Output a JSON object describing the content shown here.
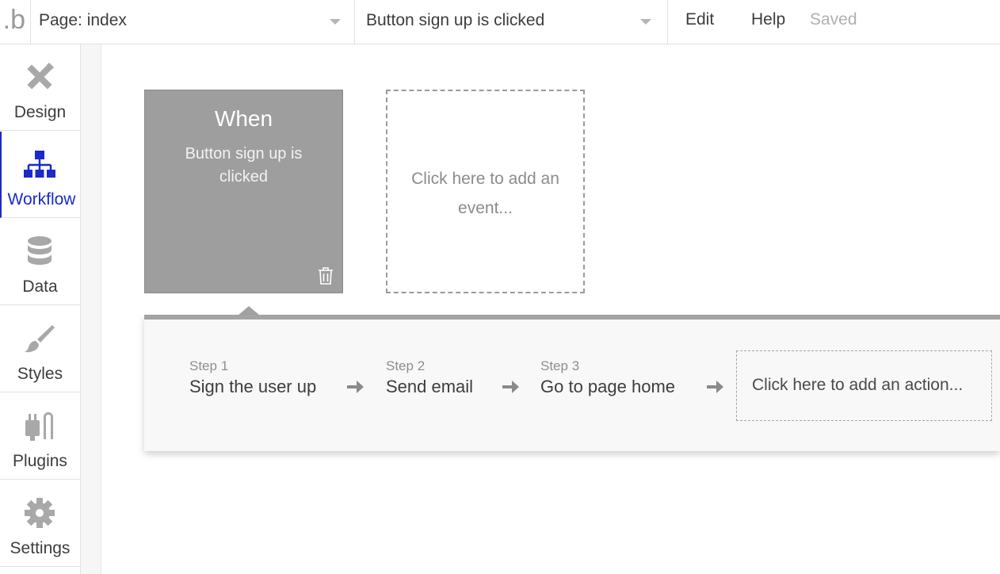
{
  "app": {
    "logo_text": ".b"
  },
  "topbar": {
    "page_select": "Page: index",
    "event_select": "Button sign up is clicked",
    "menu": {
      "edit": "Edit",
      "help": "Help",
      "status": "Saved"
    }
  },
  "sidebar": {
    "items": [
      {
        "label": "Design",
        "icon": "design-icon"
      },
      {
        "label": "Workflow",
        "icon": "workflow-icon",
        "active": true
      },
      {
        "label": "Data",
        "icon": "database-icon"
      },
      {
        "label": "Styles",
        "icon": "brush-icon"
      },
      {
        "label": "Plugins",
        "icon": "plugins-icon"
      },
      {
        "label": "Settings",
        "icon": "gear-icon"
      }
    ]
  },
  "workflow": {
    "event": {
      "heading": "When",
      "description": "Button sign up is clicked"
    },
    "add_event": "Click here to add an event...",
    "steps": [
      {
        "number": "Step 1",
        "name": "Sign the user up"
      },
      {
        "number": "Step 2",
        "name": "Send email"
      },
      {
        "number": "Step 3",
        "name": "Go to page home"
      }
    ],
    "add_action": "Click here to add an action..."
  },
  "colors": {
    "accent": "#1b2ac9",
    "event_box": "#9e9e9e",
    "icon_gray": "#a8a8a8"
  }
}
